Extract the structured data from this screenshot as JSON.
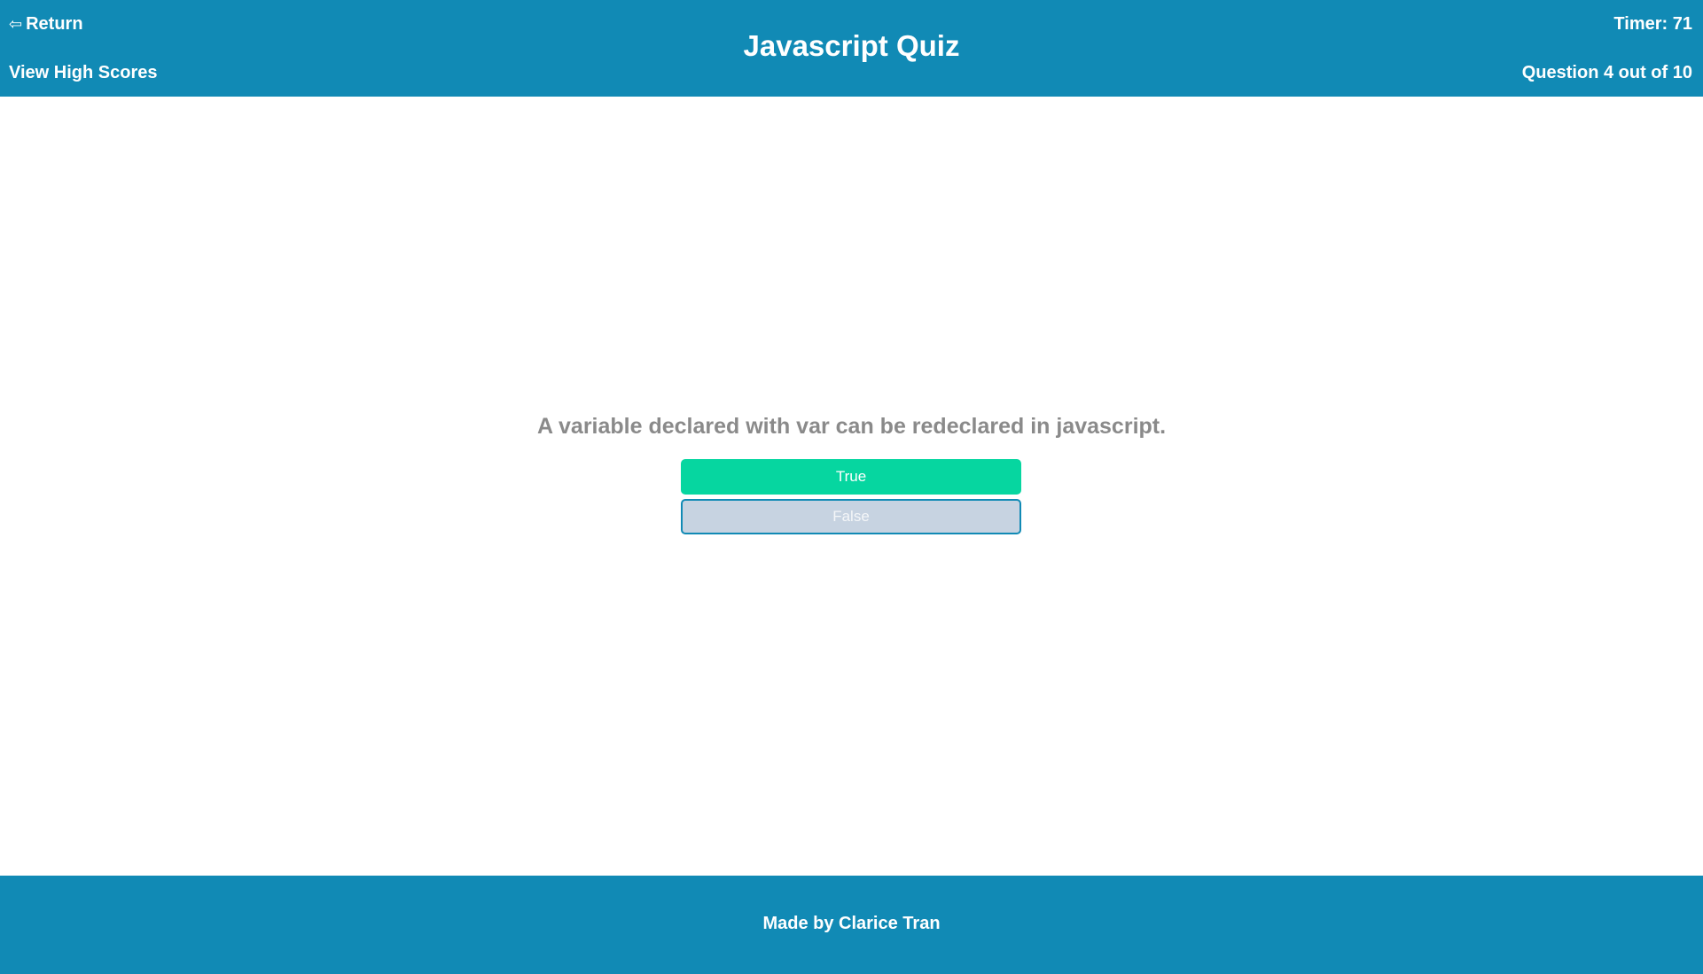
{
  "header": {
    "return_label": "Return",
    "return_icon": "⇦",
    "highscores_label": "View High Scores",
    "title": "Javascript Quiz",
    "timer": "Timer: 71",
    "question_count": "Question 4 out of 10"
  },
  "quiz": {
    "question": "A variable declared with var can be redeclared in javascript.",
    "answers": [
      {
        "label": "True",
        "state": "correct"
      },
      {
        "label": "False",
        "state": "unselected"
      }
    ]
  },
  "footer": {
    "credit": "Made by Clarice Tran"
  },
  "colors": {
    "primary": "#118ab5",
    "correct": "#06d6a0",
    "option": "#c7d3e1",
    "question_text": "#8a8a8a"
  }
}
